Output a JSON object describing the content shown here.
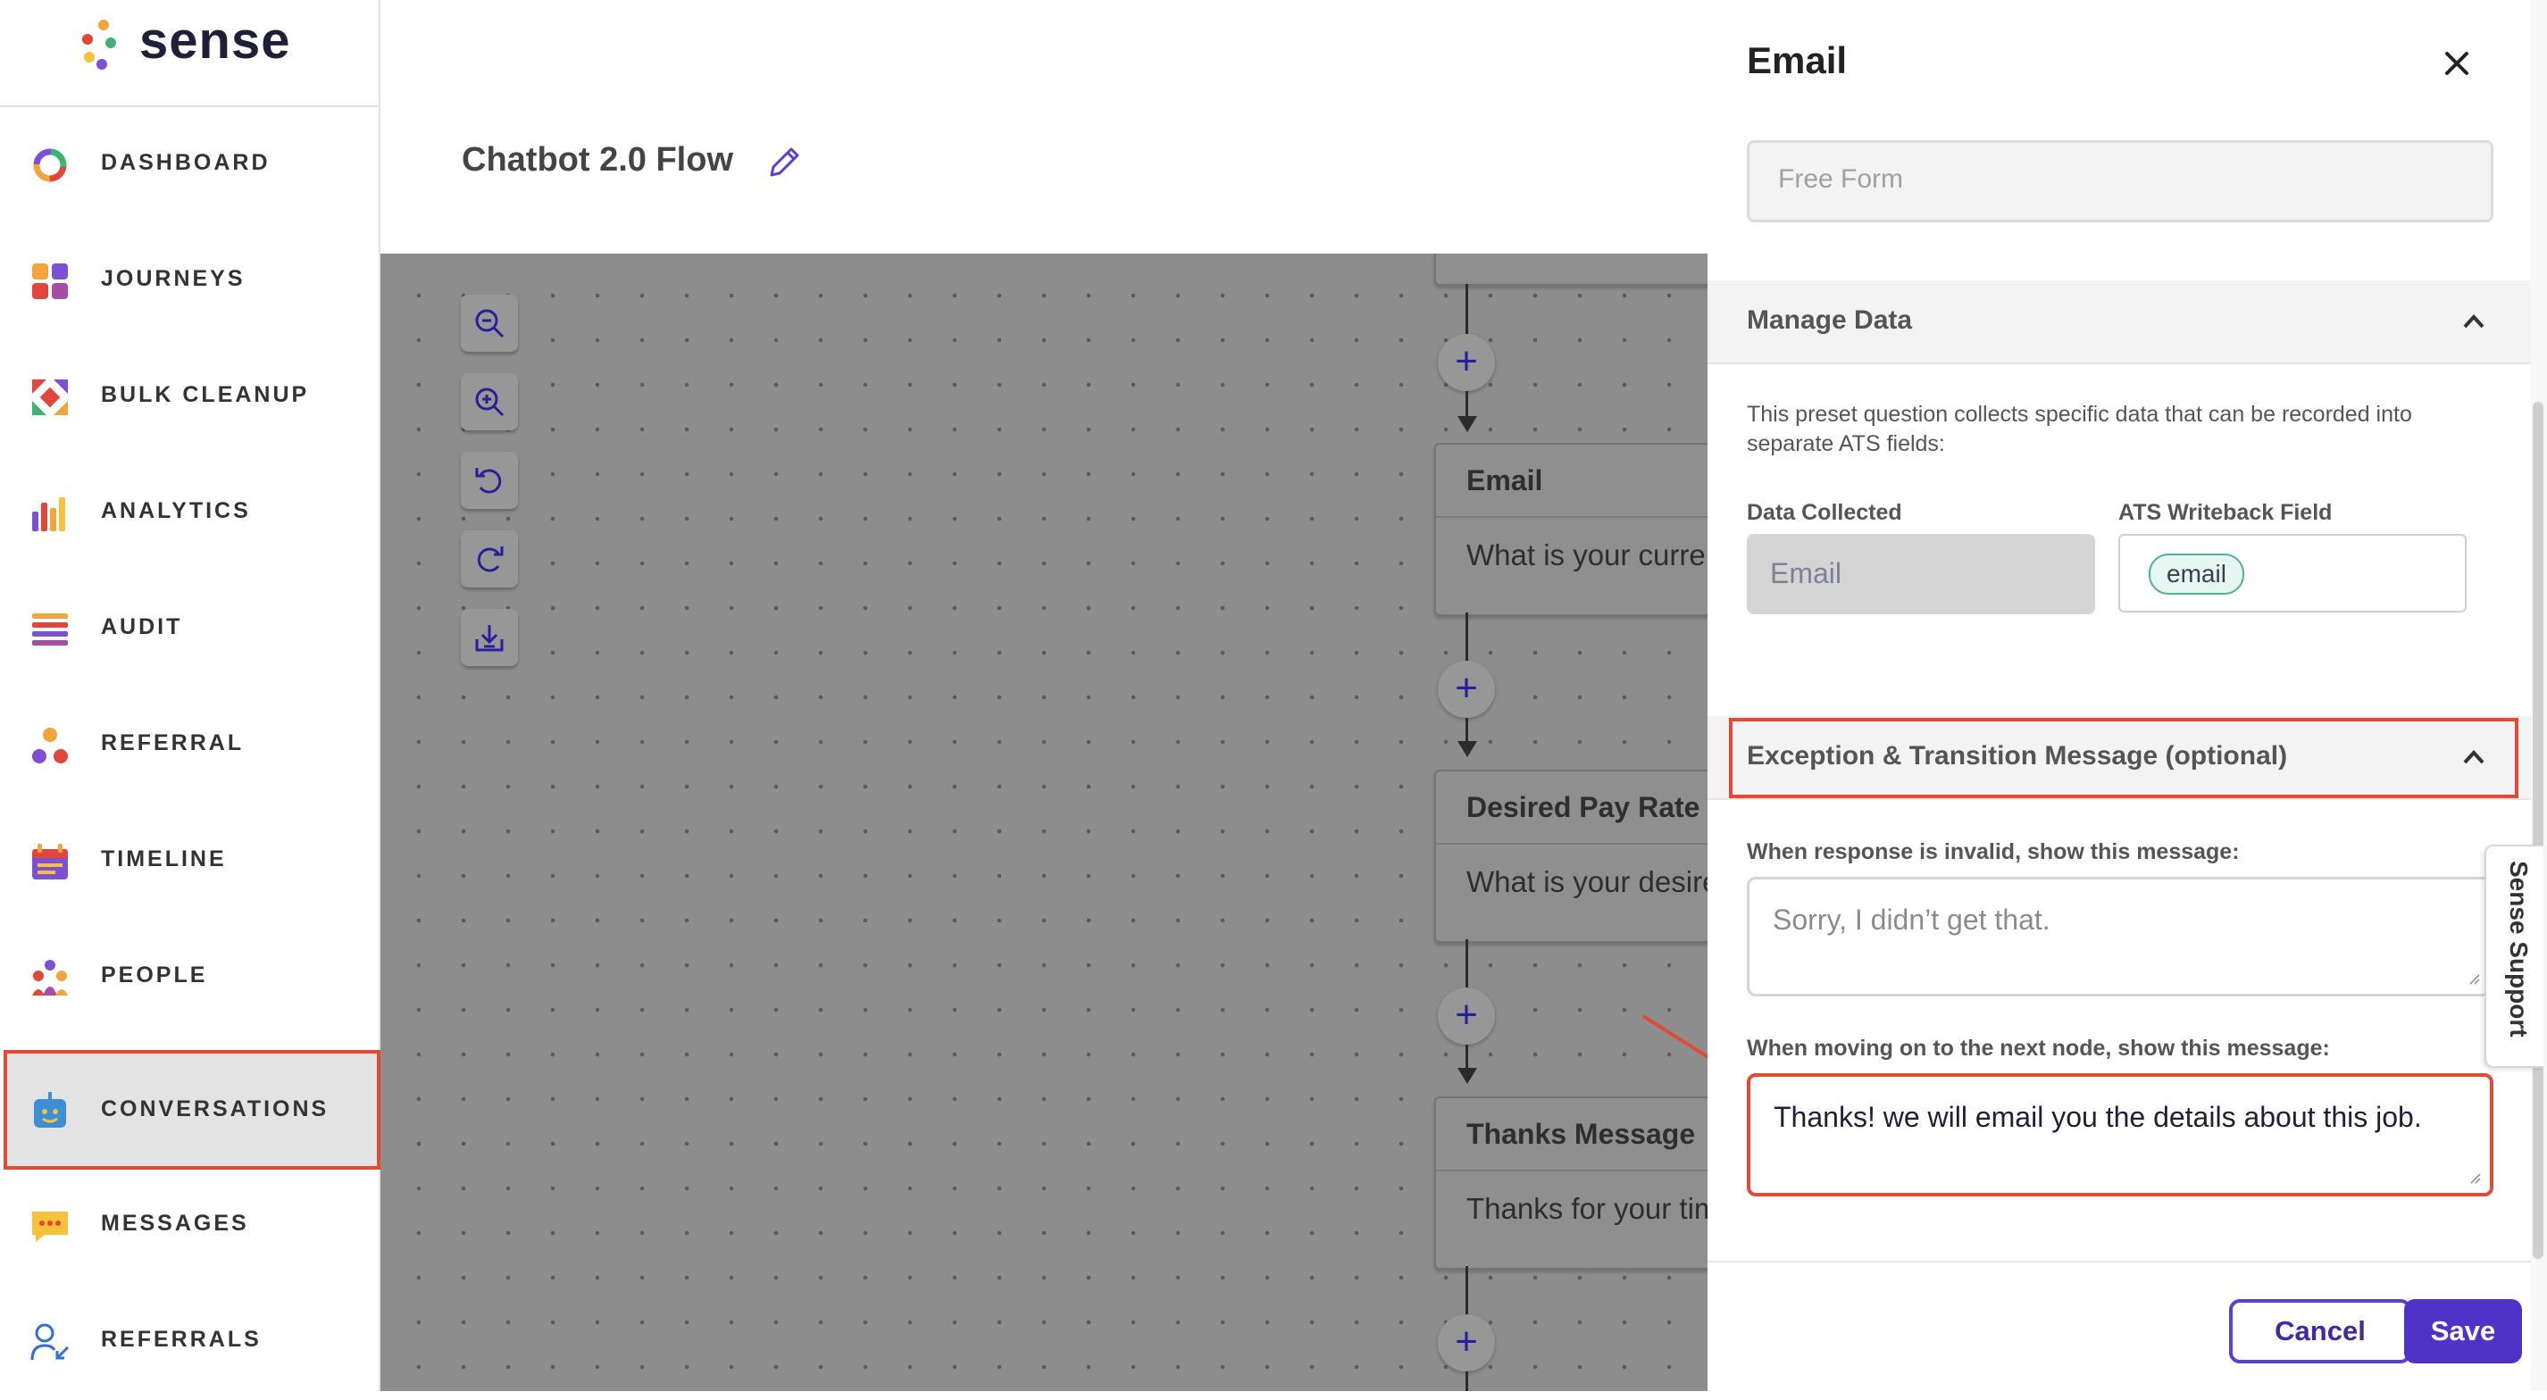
{
  "app": {
    "logo_text": "sense"
  },
  "sidebar": {
    "items": [
      {
        "label": "DASHBOARD",
        "icon": "dashboard-icon"
      },
      {
        "label": "JOURNEYS",
        "icon": "journeys-icon"
      },
      {
        "label": "BULK CLEANUP",
        "icon": "bulk-cleanup-icon"
      },
      {
        "label": "ANALYTICS",
        "icon": "analytics-icon"
      },
      {
        "label": "AUDIT",
        "icon": "audit-icon"
      },
      {
        "label": "REFERRAL",
        "icon": "referral-icon"
      },
      {
        "label": "TIMELINE",
        "icon": "timeline-icon"
      },
      {
        "label": "PEOPLE",
        "icon": "people-icon"
      },
      {
        "label": "CONVERSATIONS",
        "icon": "conversations-icon",
        "active": true
      },
      {
        "label": "MESSAGES",
        "icon": "messages-icon"
      },
      {
        "label": "REFERRALS",
        "icon": "referrals-icon"
      }
    ]
  },
  "header": {
    "flow_title": "Chatbot 2.0 Flow"
  },
  "canvas": {
    "tools": [
      "zoom-out-icon",
      "zoom-in-icon",
      "undo-icon",
      "redo-icon",
      "download-icon"
    ],
    "add_symbol": "+",
    "nodes": [
      {
        "title": "Email",
        "text": "What is your current email address?"
      },
      {
        "title": "Desired Pay Rate",
        "text": "What is your desired pay rate for your next ro"
      },
      {
        "title": "Thanks Message",
        "text": "Thanks for your time."
      }
    ]
  },
  "panel": {
    "title": "Email",
    "type_placeholder": "Free Form",
    "manage_data": {
      "heading": "Manage Data",
      "description": "This preset question collects specific data that can be recorded into separate ATS fields:",
      "data_collected_label": "Data Collected",
      "data_collected_value": "Email",
      "ats_label": "ATS Writeback Field",
      "ats_value": "email"
    },
    "exception": {
      "heading": "Exception & Transition Message (optional)",
      "invalid_label": "When response is invalid, show this message:",
      "invalid_placeholder": "Sorry, I didn’t get that.",
      "next_label": "When moving on to the next node, show this message:",
      "next_value": "Thanks! we will email you the details about this job."
    },
    "cancel_label": "Cancel",
    "save_label": "Save",
    "support_label": "Sense Support"
  },
  "colors": {
    "accent": "#4f33c9",
    "highlight": "#e24a35",
    "chip_border": "#4fb39a"
  }
}
